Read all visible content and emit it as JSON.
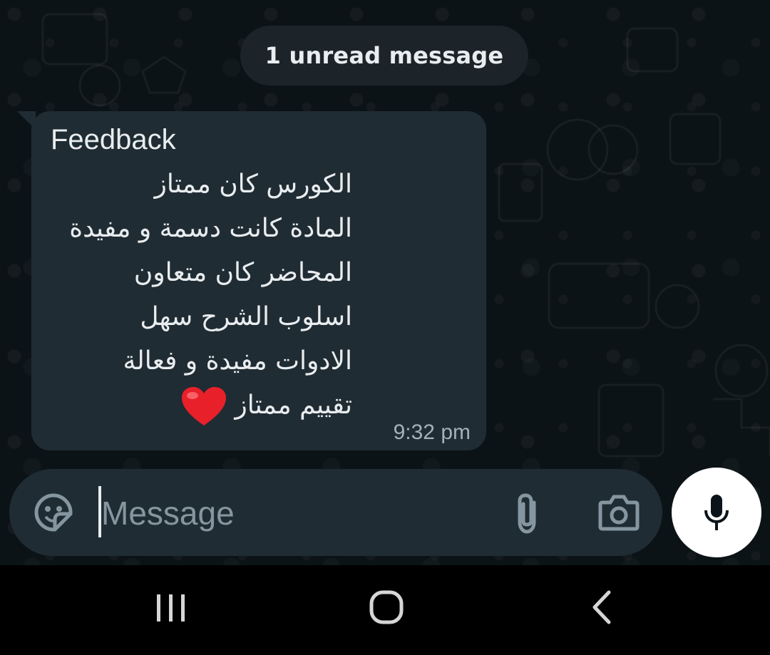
{
  "chat": {
    "unread_banner": "1 unread message",
    "message": {
      "title": "Feedback",
      "lines": [
        "الكورس كان ممتاز",
        "المادة كانت دسمة و مفيدة",
        "المحاضر كان متعاون",
        "اسلوب الشرح سهل",
        "الادوات مفيدة و فعالة",
        "تقييم ممتاز"
      ],
      "emoji": "heart-icon",
      "time": "9:32 pm"
    }
  },
  "composer": {
    "placeholder": "Message",
    "icons": [
      "sticker-icon",
      "paperclip-icon",
      "camera-icon",
      "microphone-icon"
    ]
  },
  "nav": {
    "icons": [
      "recents-icon",
      "home-icon",
      "back-icon"
    ]
  },
  "colors": {
    "background": "#0c1317",
    "bubble": "#202c33",
    "input_bar": "#1f2c33",
    "text": "#e9edef",
    "muted": "#8696a0",
    "heart": "#e8202a"
  }
}
